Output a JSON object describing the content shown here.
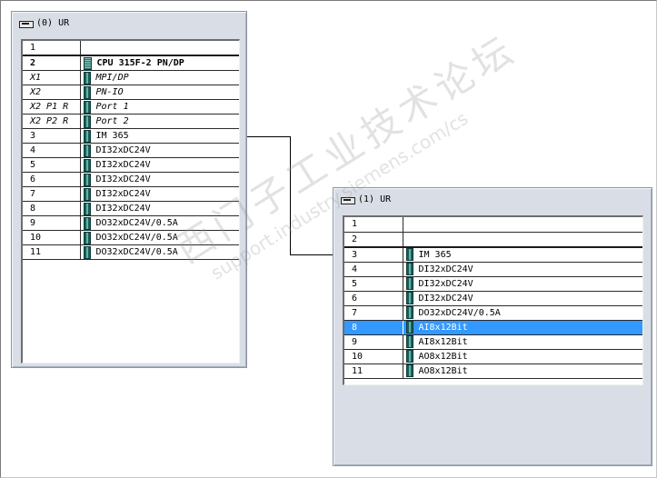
{
  "racks": [
    {
      "title": "(0) UR",
      "rows": [
        {
          "slot": "1",
          "module": "",
          "icon": "",
          "slot_style": "",
          "module_style": ""
        },
        {
          "slot": "2",
          "module": "CPU 315F-2 PN/DP",
          "icon": "cpu-icon",
          "slot_style": "bold",
          "module_style": "bold"
        },
        {
          "slot": "X1",
          "module": "MPI/DP",
          "icon": "port-icon",
          "slot_style": "italic",
          "module_style": "italic"
        },
        {
          "slot": "X2",
          "module": "PN-IO",
          "icon": "port-icon",
          "slot_style": "italic",
          "module_style": "italic"
        },
        {
          "slot": "X2 P1 R",
          "module": "Port 1",
          "icon": "port-icon",
          "slot_style": "italic",
          "module_style": "italic"
        },
        {
          "slot": "X2 P2 R",
          "module": "Port 2",
          "icon": "port-icon",
          "slot_style": "italic",
          "module_style": "italic"
        },
        {
          "slot": "3",
          "module": "IM 365",
          "icon": "module-icon",
          "slot_style": "",
          "module_style": ""
        },
        {
          "slot": "4",
          "module": "DI32xDC24V",
          "icon": "module-icon",
          "slot_style": "",
          "module_style": ""
        },
        {
          "slot": "5",
          "module": "DI32xDC24V",
          "icon": "module-icon",
          "slot_style": "",
          "module_style": ""
        },
        {
          "slot": "6",
          "module": "DI32xDC24V",
          "icon": "module-icon",
          "slot_style": "",
          "module_style": ""
        },
        {
          "slot": "7",
          "module": "DI32xDC24V",
          "icon": "module-icon",
          "slot_style": "",
          "module_style": ""
        },
        {
          "slot": "8",
          "module": "DI32xDC24V",
          "icon": "module-icon",
          "slot_style": "",
          "module_style": ""
        },
        {
          "slot": "9",
          "module": "DO32xDC24V/0.5A",
          "icon": "module-icon",
          "slot_style": "",
          "module_style": ""
        },
        {
          "slot": "10",
          "module": "DO32xDC24V/0.5A",
          "icon": "module-icon",
          "slot_style": "",
          "module_style": ""
        },
        {
          "slot": "11",
          "module": "DO32xDC24V/0.5A",
          "icon": "module-icon",
          "slot_style": "",
          "module_style": ""
        }
      ]
    },
    {
      "title": "(1) UR",
      "selected_slot": "8",
      "rows": [
        {
          "slot": "1",
          "module": "",
          "icon": ""
        },
        {
          "slot": "2",
          "module": "",
          "icon": ""
        },
        {
          "slot": "3",
          "module": "IM 365",
          "icon": "module-icon"
        },
        {
          "slot": "4",
          "module": "DI32xDC24V",
          "icon": "module-icon"
        },
        {
          "slot": "5",
          "module": "DI32xDC24V",
          "icon": "module-icon"
        },
        {
          "slot": "6",
          "module": "DI32xDC24V",
          "icon": "module-icon"
        },
        {
          "slot": "7",
          "module": "DO32xDC24V/0.5A",
          "icon": "module-icon"
        },
        {
          "slot": "8",
          "module": "AI8x12Bit",
          "icon": "module-icon"
        },
        {
          "slot": "9",
          "module": "AI8x12Bit",
          "icon": "module-icon"
        },
        {
          "slot": "10",
          "module": "AO8x12Bit",
          "icon": "module-icon"
        },
        {
          "slot": "11",
          "module": "AO8x12Bit",
          "icon": "module-icon"
        }
      ]
    }
  ],
  "watermark": {
    "line1": "西门子工业技术论坛",
    "line2": "support.industry.siemens.com/cs"
  },
  "colors": {
    "selection": "#3399ff",
    "rack_frame": "#d9dee6",
    "module_icon": "#1b5f5a"
  }
}
